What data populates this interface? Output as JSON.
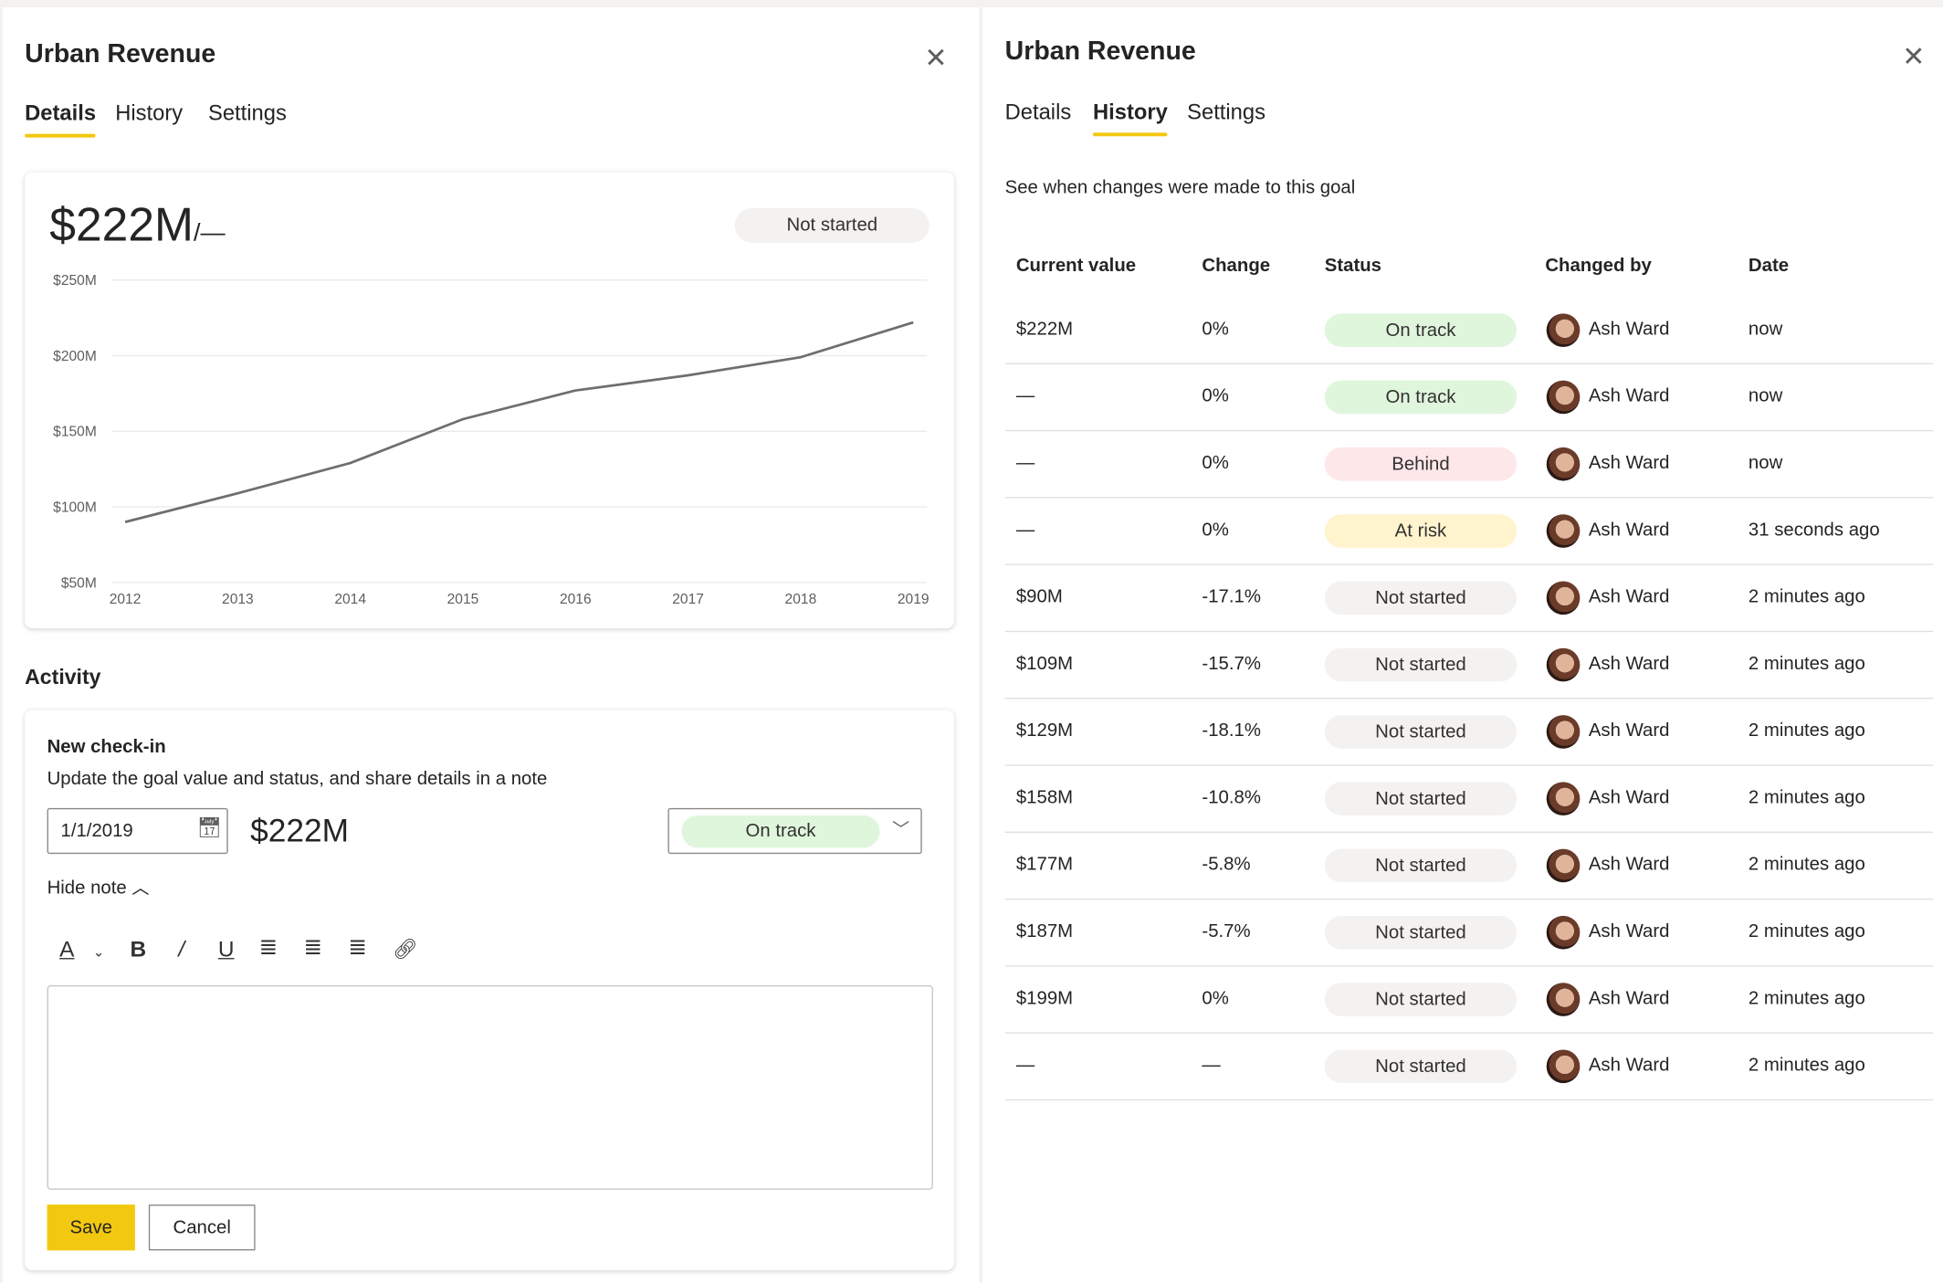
{
  "left": {
    "title": "Urban Revenue",
    "tabs": [
      "Details",
      "History",
      "Settings"
    ],
    "active_tab": "Details",
    "summary": {
      "value": "$222M",
      "target": "/—",
      "status": "Not started"
    },
    "activity_label": "Activity",
    "checkin": {
      "title": "New check-in",
      "subtitle": "Update the goal value and status, and share details in a note",
      "date": "1/1/2019",
      "value": "$222M",
      "status": "On track",
      "hide_note": "Hide note",
      "save": "Save",
      "cancel": "Cancel"
    }
  },
  "chart_data": {
    "type": "line",
    "categories": [
      "2012",
      "2013",
      "2014",
      "2015",
      "2016",
      "2017",
      "2018",
      "2019"
    ],
    "values": [
      90,
      109,
      129,
      158,
      177,
      187,
      199,
      222
    ],
    "y_ticks": [
      "$50M",
      "$100M",
      "$150M",
      "$200M",
      "$250M"
    ],
    "ylim": [
      50,
      250
    ],
    "grid": true,
    "line_color": "#6e6e6e"
  },
  "right": {
    "title": "Urban Revenue",
    "tabs": [
      "Details",
      "History",
      "Settings"
    ],
    "active_tab": "History",
    "description": "See when changes were made to this goal",
    "columns": [
      "Current value",
      "Change",
      "Status",
      "Changed by",
      "Date"
    ],
    "rows": [
      {
        "value": "$222M",
        "change": "0%",
        "status": "On track",
        "by": "Ash Ward",
        "date": "now"
      },
      {
        "value": "—",
        "change": "0%",
        "status": "On track",
        "by": "Ash Ward",
        "date": "now"
      },
      {
        "value": "—",
        "change": "0%",
        "status": "Behind",
        "by": "Ash Ward",
        "date": "now"
      },
      {
        "value": "—",
        "change": "0%",
        "status": "At risk",
        "by": "Ash Ward",
        "date": "31 seconds ago"
      },
      {
        "value": "$90M",
        "change": "-17.1%",
        "status": "Not started",
        "by": "Ash Ward",
        "date": "2 minutes ago"
      },
      {
        "value": "$109M",
        "change": "-15.7%",
        "status": "Not started",
        "by": "Ash Ward",
        "date": "2 minutes ago"
      },
      {
        "value": "$129M",
        "change": "-18.1%",
        "status": "Not started",
        "by": "Ash Ward",
        "date": "2 minutes ago"
      },
      {
        "value": "$158M",
        "change": "-10.8%",
        "status": "Not started",
        "by": "Ash Ward",
        "date": "2 minutes ago"
      },
      {
        "value": "$177M",
        "change": "-5.8%",
        "status": "Not started",
        "by": "Ash Ward",
        "date": "2 minutes ago"
      },
      {
        "value": "$187M",
        "change": "-5.7%",
        "status": "Not started",
        "by": "Ash Ward",
        "date": "2 minutes ago"
      },
      {
        "value": "$199M",
        "change": "0%",
        "status": "Not started",
        "by": "Ash Ward",
        "date": "2 minutes ago"
      },
      {
        "value": "—",
        "change": "—",
        "status": "Not started",
        "by": "Ash Ward",
        "date": "2 minutes ago"
      }
    ]
  },
  "status_colors": {
    "On track": "#dff6dd",
    "Behind": "#fde7e9",
    "At risk": "#fff4ce",
    "Not started": "#f3f2f1"
  },
  "accent": "#f2c811"
}
